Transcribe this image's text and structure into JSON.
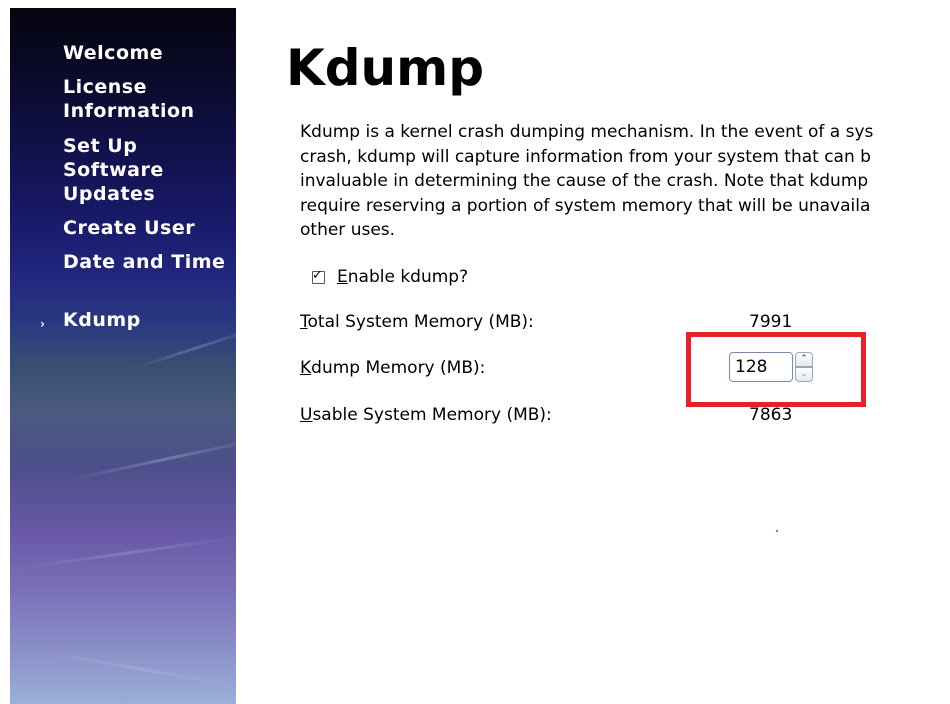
{
  "sidebar": {
    "items": [
      {
        "label": "Welcome"
      },
      {
        "label": "License Information"
      },
      {
        "label": "Set Up Software Updates"
      },
      {
        "label": "Create User"
      },
      {
        "label": "Date and Time"
      },
      {
        "label": "Kdump",
        "active": true
      }
    ],
    "active_marker": "›"
  },
  "page": {
    "title": "Kdump",
    "description_lines": [
      "Kdump is a kernel crash dumping mechanism. In the event of a sys",
      "crash, kdump will capture information from your system that can b",
      "invaluable in determining the cause of the crash. Note that kdump",
      "require reserving a portion of system memory that will be unavaila",
      "other uses."
    ]
  },
  "form": {
    "enable_kdump": {
      "label": "Enable kdump?",
      "checked": true,
      "mark": "✓"
    },
    "total_memory": {
      "label": "Total System Memory (MB):",
      "value": "7991"
    },
    "kdump_memory": {
      "label": "Kdump Memory (MB):",
      "value": "128",
      "up": "⌃",
      "down": "⌄"
    },
    "usable_memory": {
      "label": "Usable System Memory (MB):",
      "value": "7863"
    }
  },
  "colors": {
    "highlight": "#e8202a",
    "sidebar_top": "#050510",
    "sidebar_bottom": "#9ab0d8"
  }
}
